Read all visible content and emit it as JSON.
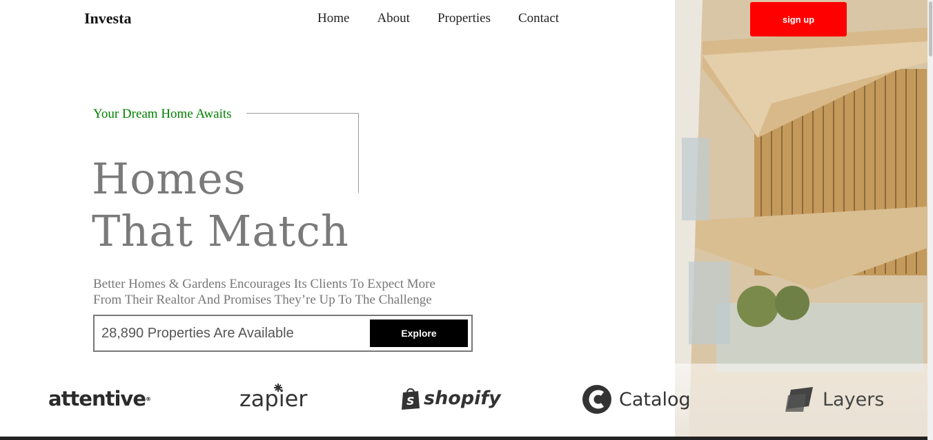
{
  "header": {
    "logo": "Investa",
    "nav": [
      "Home",
      "About",
      "Properties",
      "Contact"
    ],
    "signup_label": "sign up"
  },
  "hero": {
    "tagline": "Your Dream Home Awaits",
    "headline_line1": "Homes",
    "headline_line2": "That Match",
    "description_line1": "Better Homes & Gardens Encourages Its Clients To Expect More",
    "description_line2": "From Their Realtor And Promises They’re Up To The Challenge",
    "search_text": "28,890 Properties Are Available",
    "explore_label": "Explore"
  },
  "brands": [
    "attentive",
    "zapier",
    "shopify",
    "Catalog",
    "Layers"
  ],
  "colors": {
    "accent": "#ff0000",
    "tagline": "#008000",
    "headline": "#7a7a7a"
  }
}
